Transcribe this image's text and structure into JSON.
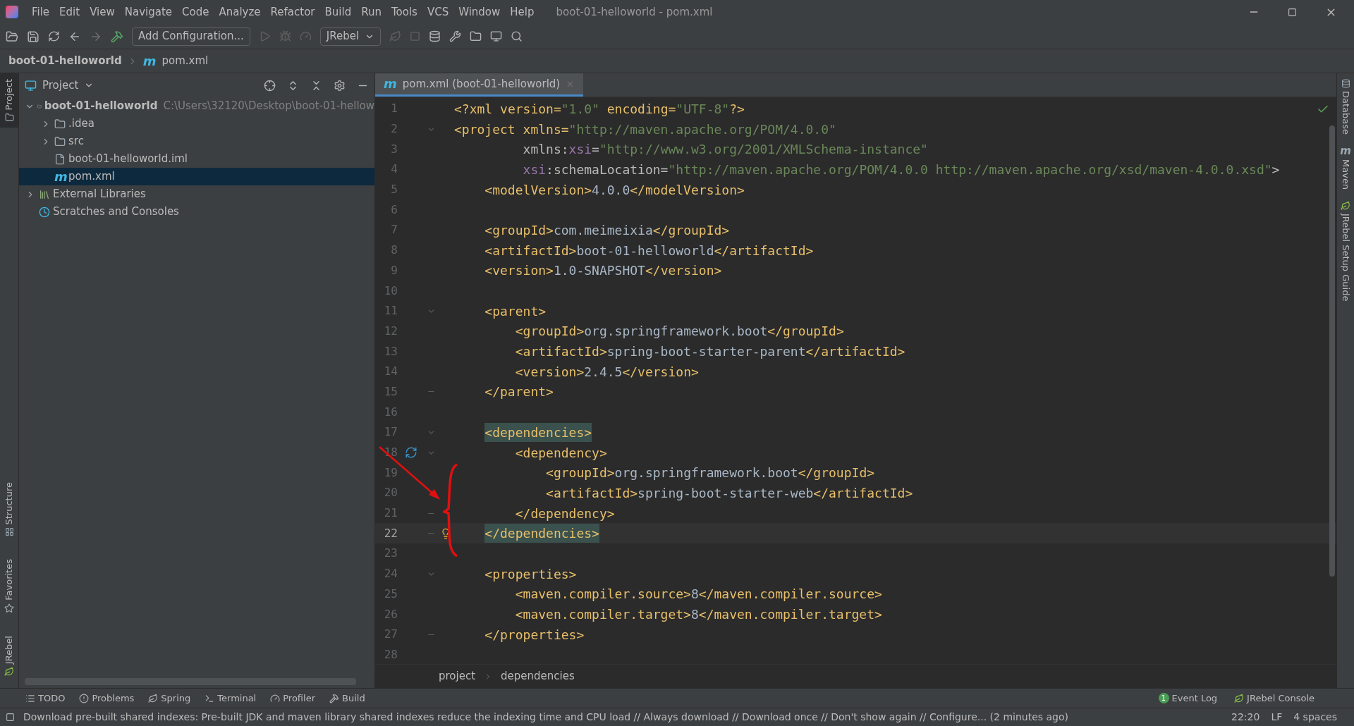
{
  "menu_bar": {
    "items": [
      "File",
      "Edit",
      "View",
      "Navigate",
      "Code",
      "Analyze",
      "Refactor",
      "Build",
      "Run",
      "Tools",
      "VCS",
      "Window",
      "Help"
    ],
    "title": "boot-01-helloworld - pom.xml"
  },
  "toolbar": {
    "run_config": "Add Configuration...",
    "jrebel": "JRebel"
  },
  "nav_bar": {
    "project": "boot-01-helloworld",
    "file_glyph": "m",
    "file": "pom.xml"
  },
  "left_stripe": [
    {
      "label": "Project",
      "kind": "folder",
      "selected": true
    },
    {
      "label": "Structure",
      "kind": "structure",
      "selected": false
    },
    {
      "label": "Favorites",
      "kind": "star",
      "selected": false
    },
    {
      "label": "JRebel",
      "kind": "leaf",
      "selected": false
    }
  ],
  "project_panel": {
    "title": "Project",
    "tree": [
      {
        "label": "boot-01-helloworld",
        "kind": "module",
        "path": "C:\\Users\\32120\\Desktop\\boot-01-hellow",
        "expanded": true,
        "selected": false,
        "children": [
          {
            "label": ".idea",
            "kind": "folder",
            "expanded": false,
            "selected": false
          },
          {
            "label": "src",
            "kind": "folder",
            "expanded": false,
            "selected": false
          },
          {
            "label": "boot-01-helloworld.iml",
            "kind": "file",
            "selected": false
          },
          {
            "label": "pom.xml",
            "kind": "maven",
            "glyph": "m",
            "selected": true
          }
        ]
      },
      {
        "label": "External Libraries",
        "kind": "libraries",
        "expanded": false,
        "selected": false
      },
      {
        "label": "Scratches and Consoles",
        "kind": "scratches",
        "selected": false
      }
    ]
  },
  "editor": {
    "tabs": [
      {
        "label": "pom.xml (boot-01-helloworld)",
        "glyph": "m",
        "selected": true
      }
    ],
    "lines": [
      {
        "n": "1",
        "text": "<?xml version=\"1.0\" encoding=\"UTF-8\"?>"
      },
      {
        "n": "2",
        "text": "<project xmlns=\"http://maven.apache.org/POM/4.0.0\"",
        "fold_start": true
      },
      {
        "n": "3",
        "text": "         xmlns:xsi=\"http://www.w3.org/2001/XMLSchema-instance\""
      },
      {
        "n": "4",
        "text": "         xsi:schemaLocation=\"http://maven.apache.org/POM/4.0.0 http://maven.apache.org/xsd/maven-4.0.0.xsd\">"
      },
      {
        "n": "5",
        "text": "    <modelVersion>4.0.0</modelVersion>"
      },
      {
        "n": "6"
      },
      {
        "n": "7",
        "text": "    <groupId>com.meimeixia</groupId>"
      },
      {
        "n": "8",
        "text": "    <artifactId>boot-01-helloworld</artifactId>"
      },
      {
        "n": "9",
        "text": "    <version>1.0-SNAPSHOT</version>"
      },
      {
        "n": "10"
      },
      {
        "n": "11",
        "text": "    <parent>",
        "fold_start": true
      },
      {
        "n": "12",
        "text": "        <groupId>org.springframework.boot</groupId>"
      },
      {
        "n": "13",
        "text": "        <artifactId>spring-boot-starter-parent</artifactId>"
      },
      {
        "n": "14",
        "text": "        <version>2.4.5</version>"
      },
      {
        "n": "15",
        "text": "    </parent>",
        "fold_end": true
      },
      {
        "n": "16"
      },
      {
        "n": "17",
        "text": "    <dependencies>",
        "fold_start": true,
        "highlighted": true
      },
      {
        "n": "18",
        "text": "        <dependency>",
        "fold_start": true,
        "update_mark": true
      },
      {
        "n": "19",
        "text": "            <groupId>org.springframework.boot</groupId>"
      },
      {
        "n": "20",
        "text": "            <artifactId>spring-boot-starter-web</artifactId>"
      },
      {
        "n": "21",
        "text": "        </dependency>",
        "fold_end": true
      },
      {
        "n": "22",
        "text": "    </dependencies>",
        "fold_end": true,
        "highlighted": true,
        "current": true,
        "intention_bulb": true
      },
      {
        "n": "23"
      },
      {
        "n": "24",
        "text": "    <properties>",
        "fold_start": true
      },
      {
        "n": "25",
        "text": "        <maven.compiler.source>8</maven.compiler.source>"
      },
      {
        "n": "26",
        "text": "        <maven.compiler.target>8</maven.compiler.target>"
      },
      {
        "n": "27",
        "text": "    </properties>",
        "fold_end": true
      },
      {
        "n": "28"
      }
    ],
    "breadcrumbs": [
      "project",
      "dependencies"
    ]
  },
  "right_stripe": [
    {
      "label": "Database",
      "kind": "database"
    },
    {
      "label": "Maven",
      "kind": "maven",
      "glyph": "m"
    },
    {
      "label": "JRebel Setup Guide",
      "kind": "leaf"
    }
  ],
  "tool_tabs": [
    {
      "label": "TODO",
      "kind": "list"
    },
    {
      "label": "Problems",
      "kind": "alert"
    },
    {
      "label": "Spring",
      "kind": "leaf"
    },
    {
      "label": "Terminal",
      "kind": "terminal"
    },
    {
      "label": "Profiler",
      "kind": "gauge"
    },
    {
      "label": "Build",
      "kind": "hammer"
    }
  ],
  "tool_tabs_right": [
    {
      "label": "Event Log",
      "badge": "1"
    },
    {
      "label": "JRebel Console"
    }
  ],
  "status_bar": {
    "message": "Download pre-built shared indexes: Pre-built JDK and maven library shared indexes reduce the indexing time and CPU load // Always download // Download once // Don't show again // Configure... (2 minutes ago)",
    "position": "22:20",
    "line_sep": "LF",
    "indent": "4 spaces"
  }
}
